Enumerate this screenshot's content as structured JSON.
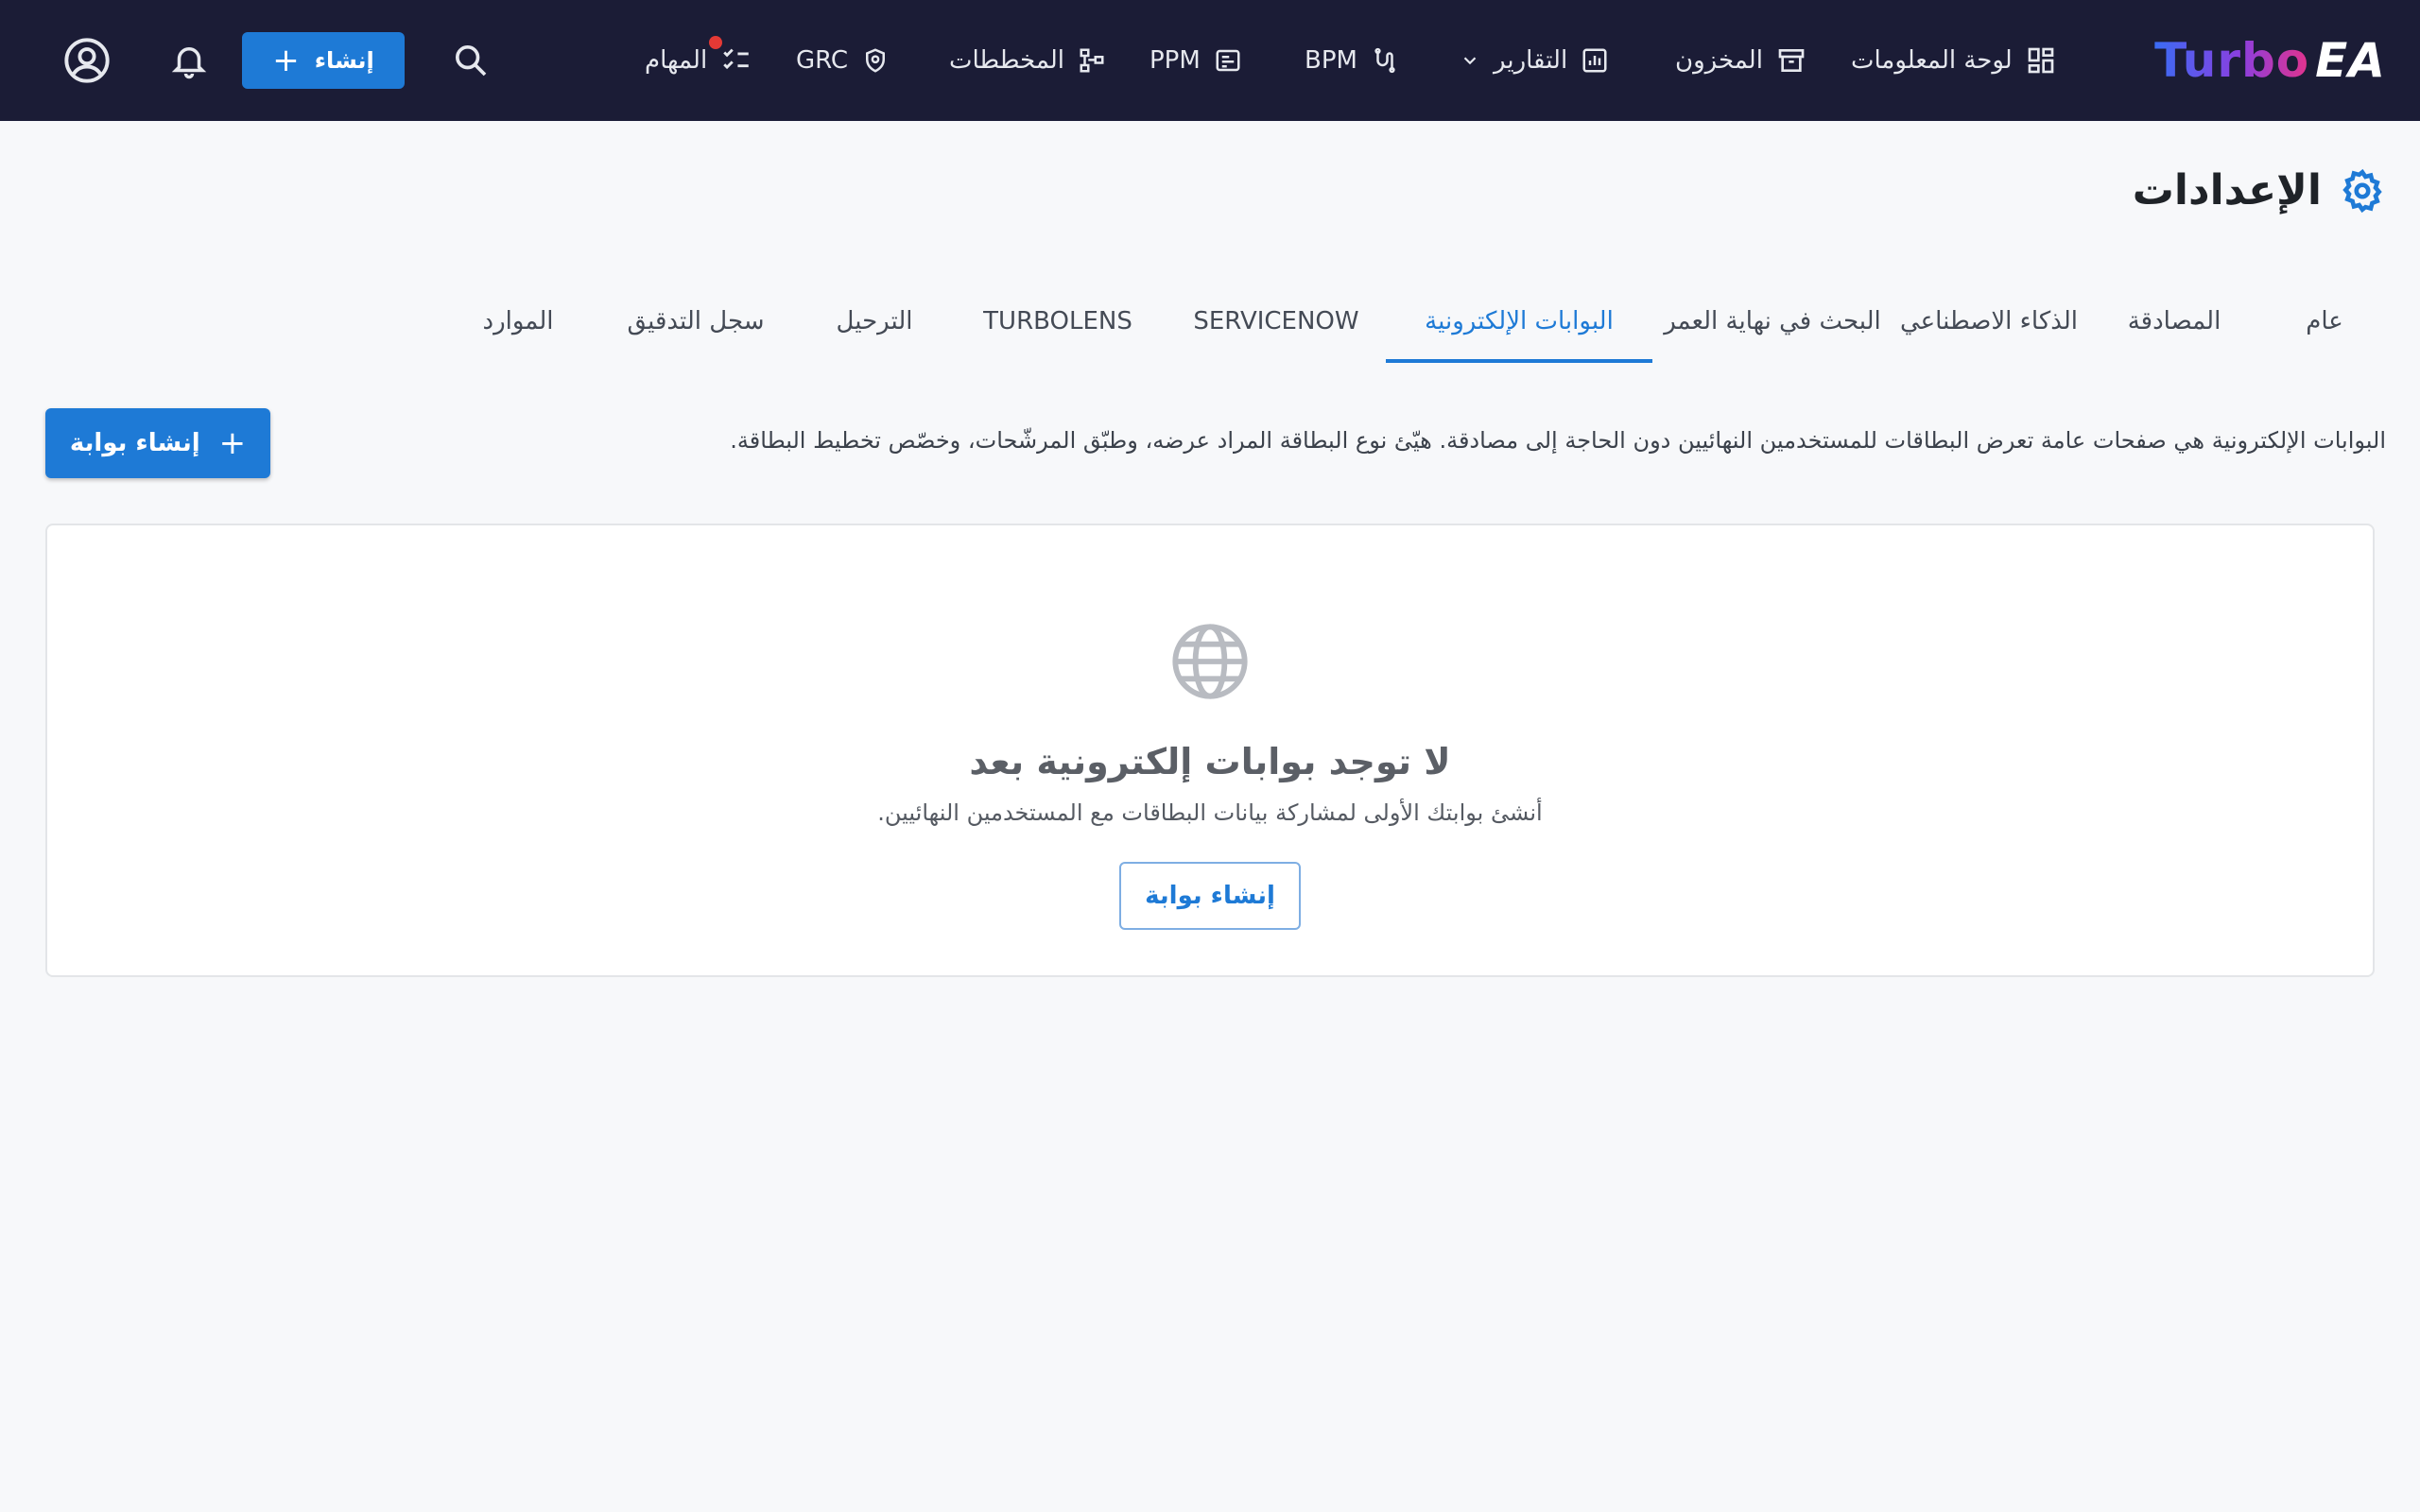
{
  "app": {
    "logo_text_1": "Turbo",
    "logo_text_2": "EA"
  },
  "topbar": {
    "nav": [
      {
        "label": "لوحة المعلومات",
        "icon": "dashboard-icon"
      },
      {
        "label": "المخزون",
        "icon": "archive-icon"
      },
      {
        "label": "التقارير",
        "icon": "report-chart-icon"
      },
      {
        "label": "BPM",
        "icon": "process-flow-icon"
      },
      {
        "label": "PPM",
        "icon": "project-board-icon"
      },
      {
        "label": "المخططات",
        "icon": "diagram-icon"
      },
      {
        "label": "GRC",
        "icon": "shield-icon"
      },
      {
        "label": "المهام",
        "icon": "checklist-icon"
      }
    ],
    "create_label": "إنشاء",
    "notification_dot_color": "#e53935"
  },
  "page": {
    "title": "الإعدادات"
  },
  "tabs": [
    {
      "label": "عام"
    },
    {
      "label": "المصادقة"
    },
    {
      "label": "الذكاء الاصطناعي"
    },
    {
      "label": "البحث في نهاية العمر"
    },
    {
      "label": "البوابات الإلكترونية",
      "active": true
    },
    {
      "label": "SERVICENOW"
    },
    {
      "label": "TURBOLENS"
    },
    {
      "label": "الترحيل"
    },
    {
      "label": "سجل التدقيق"
    },
    {
      "label": "الموارد"
    }
  ],
  "portals": {
    "description": "البوابات الإلكترونية هي صفحات عامة تعرض البطاقات للمستخدمين النهائيين دون الحاجة إلى مصادقة. هيّئ نوع البطاقة المراد عرضه، وطبّق المرشّحات، وخصّص تخطيط البطاقة.",
    "create_button": "إنشاء بوابة",
    "empty_title": "لا توجد بوابات إلكترونية بعد",
    "empty_subtitle": "أنشئ بوابتك الأولى لمشاركة بيانات البطاقات مع المستخدمين النهائيين.",
    "empty_button": "إنشاء بوابة"
  },
  "colors": {
    "topbar_bg": "#1b1c36",
    "accent": "#1e7ad6"
  }
}
